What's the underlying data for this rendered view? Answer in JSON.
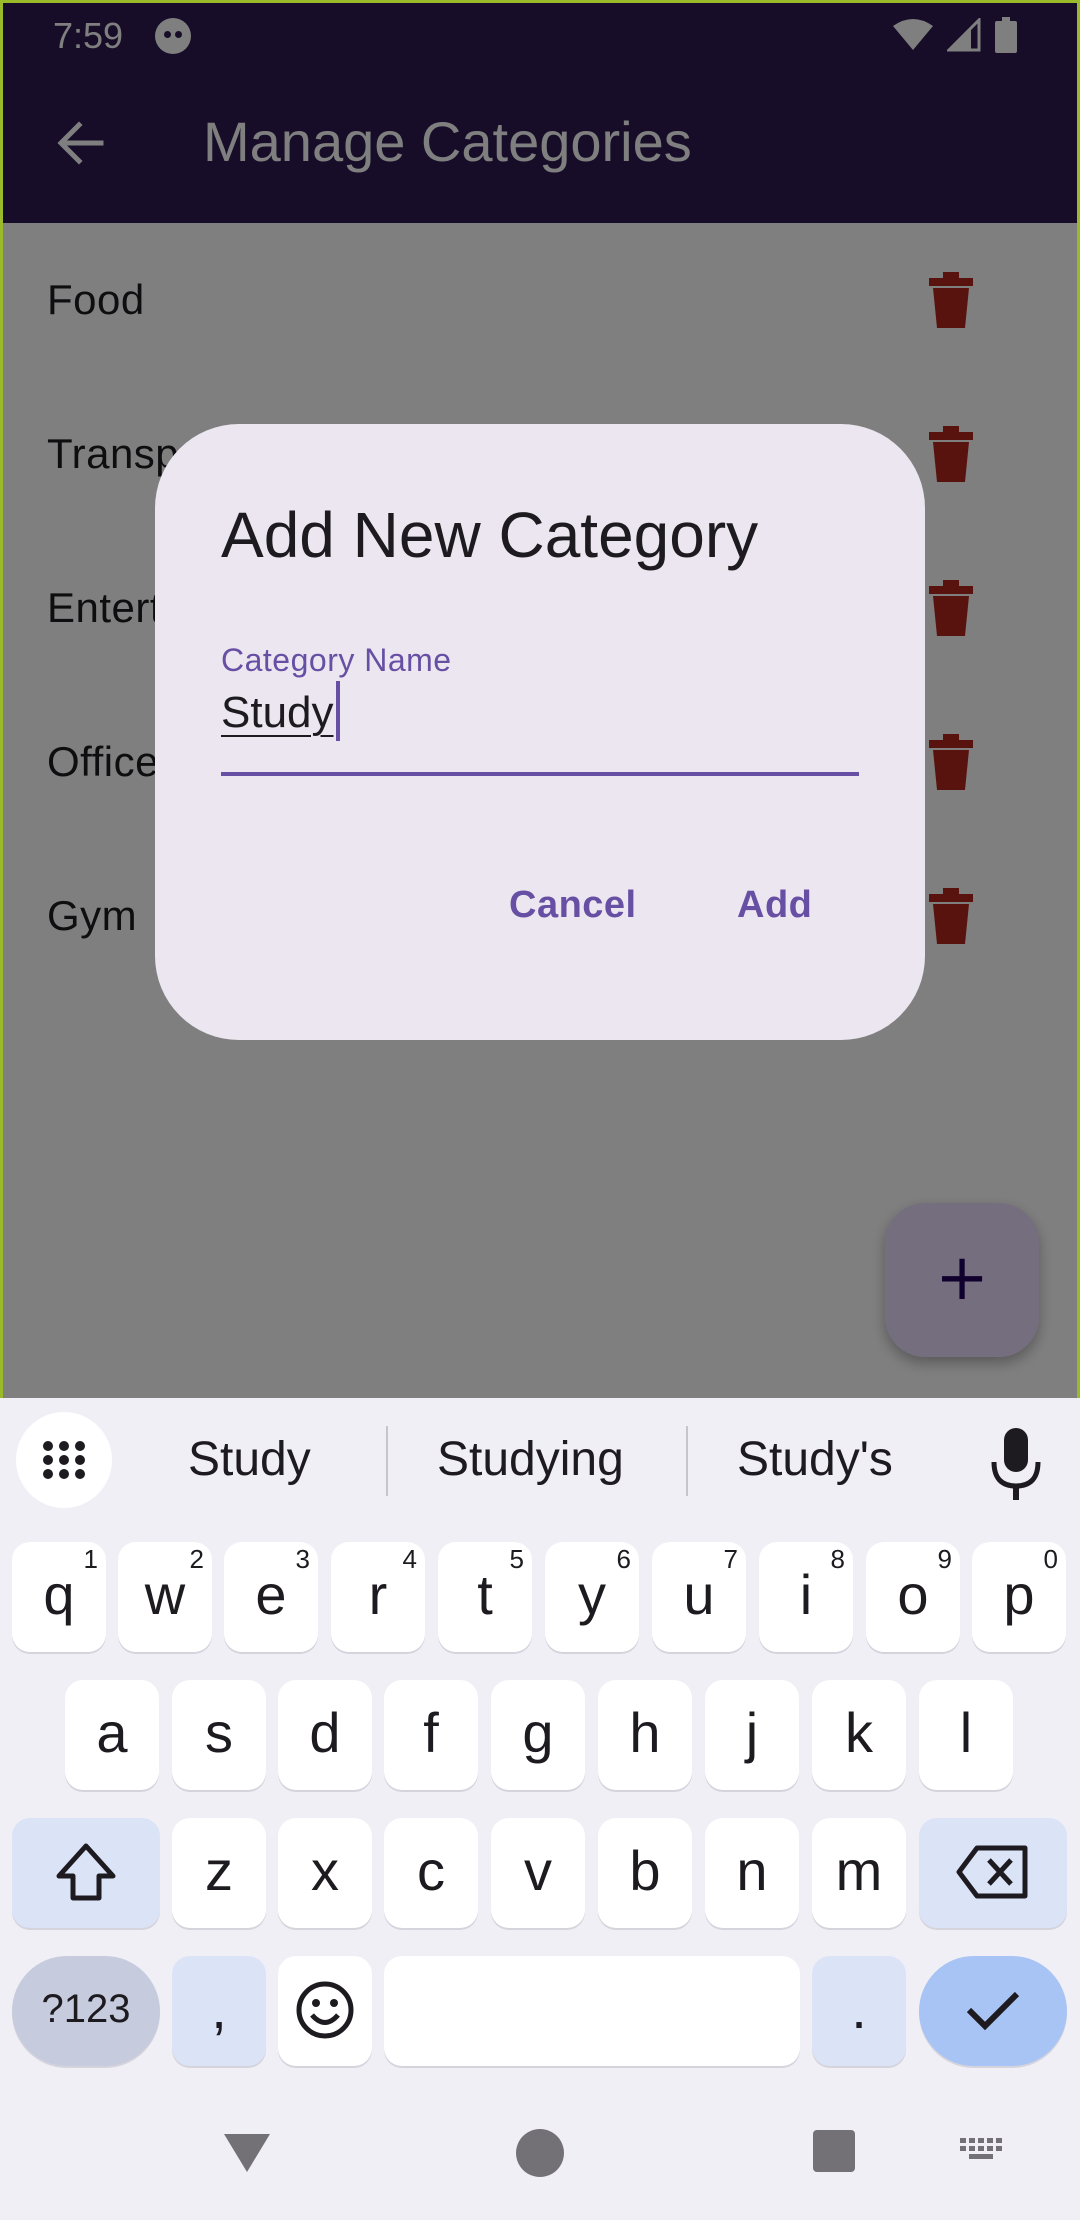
{
  "status_bar": {
    "time": "7:59"
  },
  "app_bar": {
    "title": "Manage Categories"
  },
  "categories": [
    {
      "name": "Food"
    },
    {
      "name": "Transportation"
    },
    {
      "name": "Entertainment"
    },
    {
      "name": "Office"
    },
    {
      "name": "Gym"
    }
  ],
  "dialog": {
    "title": "Add New Category",
    "field_label": "Category Name",
    "field_value": "Study",
    "cancel_label": "Cancel",
    "add_label": "Add"
  },
  "keyboard": {
    "suggestions": [
      "Study",
      "Studying",
      "Study's"
    ],
    "row1": [
      {
        "key": "q",
        "hint": "1"
      },
      {
        "key": "w",
        "hint": "2"
      },
      {
        "key": "e",
        "hint": "3"
      },
      {
        "key": "r",
        "hint": "4"
      },
      {
        "key": "t",
        "hint": "5"
      },
      {
        "key": "y",
        "hint": "6"
      },
      {
        "key": "u",
        "hint": "7"
      },
      {
        "key": "i",
        "hint": "8"
      },
      {
        "key": "o",
        "hint": "9"
      },
      {
        "key": "p",
        "hint": "0"
      }
    ],
    "row2": [
      "a",
      "s",
      "d",
      "f",
      "g",
      "h",
      "j",
      "k",
      "l"
    ],
    "row3": [
      "z",
      "x",
      "c",
      "v",
      "b",
      "n",
      "m"
    ],
    "symbols_label": "?123",
    "comma_label": ",",
    "period_label": "."
  },
  "colors": {
    "app_bar": "#2e1a52",
    "accent": "#6750a4",
    "delete_icon": "#b3261e",
    "dialog_bg": "#ece6f0",
    "fab_bg": "#eaddff"
  },
  "icons": {
    "back": "arrow-left-icon",
    "delete": "trash-icon",
    "fab": "plus-icon",
    "mic": "microphone-icon",
    "apps": "grid-icon",
    "shift": "shift-icon",
    "backspace": "backspace-icon",
    "emoji": "emoji-icon",
    "enter": "checkmark-icon"
  }
}
